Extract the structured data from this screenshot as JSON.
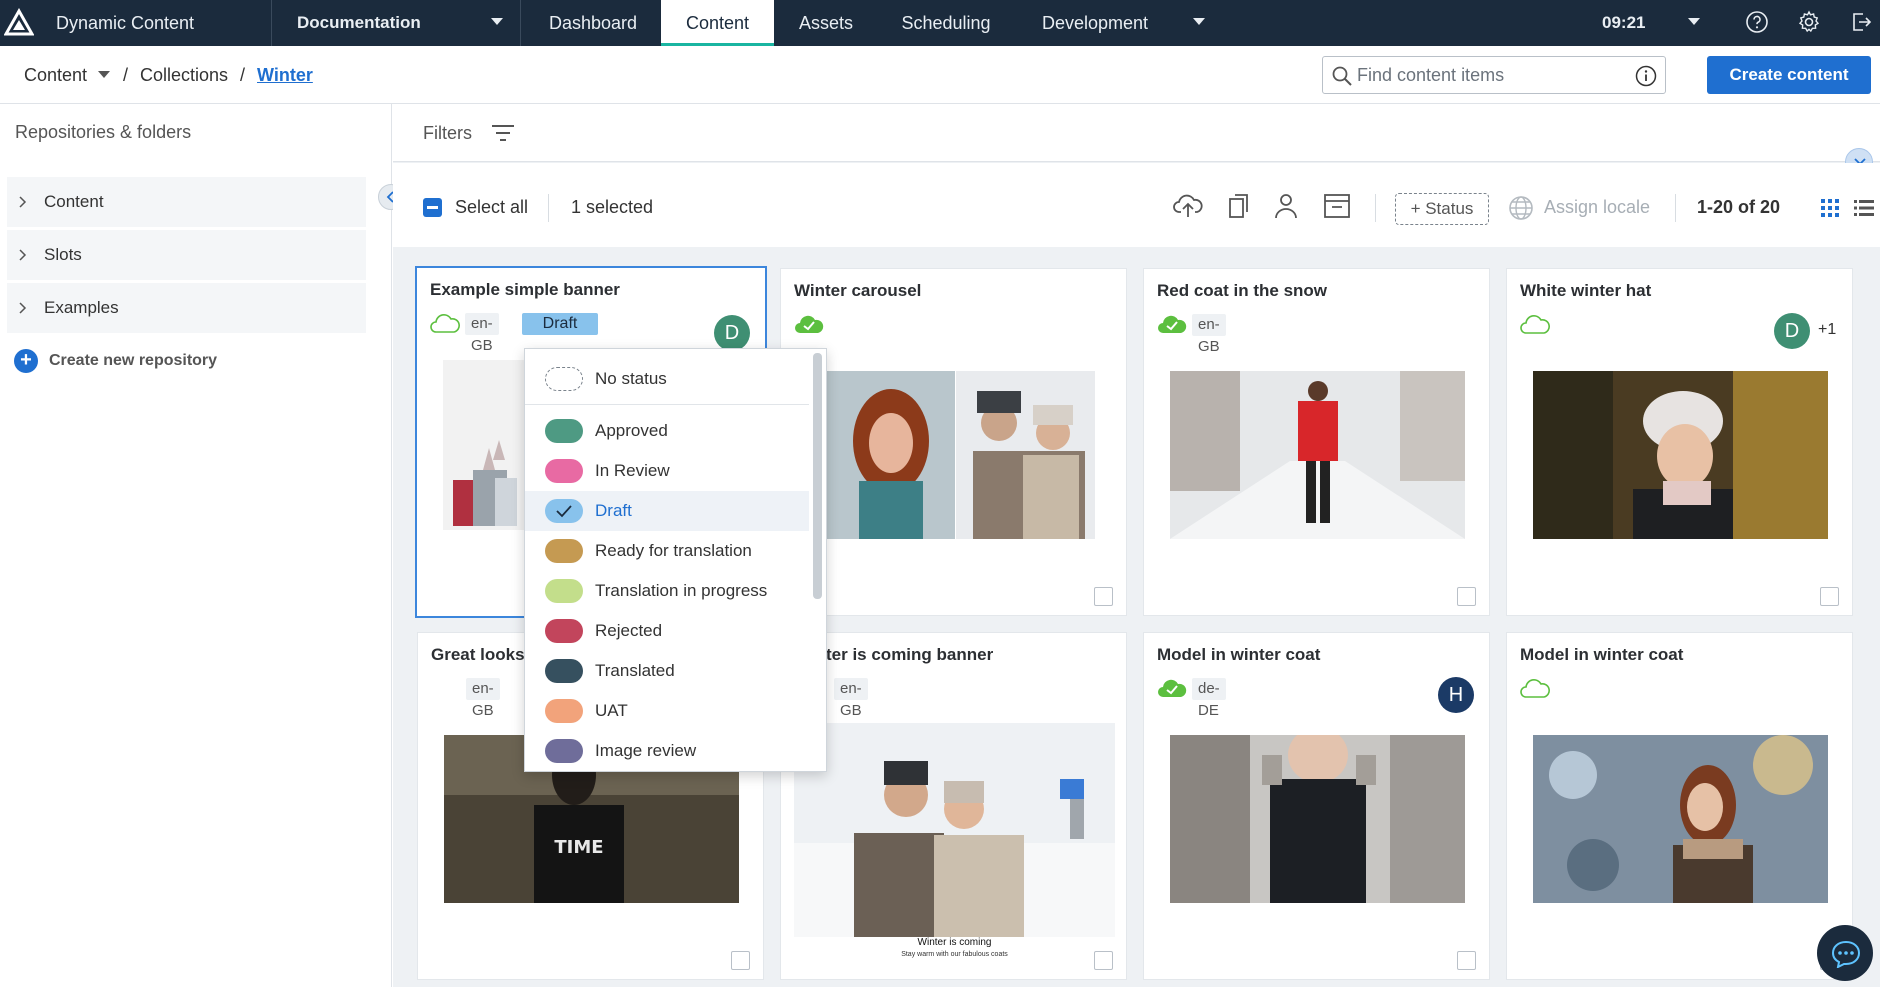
{
  "topbar": {
    "app_name": "Dynamic Content",
    "hub_name": "Documentation",
    "tabs": [
      {
        "label": "Dashboard"
      },
      {
        "label": "Content"
      },
      {
        "label": "Assets"
      },
      {
        "label": "Scheduling"
      },
      {
        "label": "Development"
      }
    ],
    "active_tab": "Content",
    "time": "09:21"
  },
  "breadcrumb": {
    "root": "Content",
    "sep1": "/",
    "collections": "Collections",
    "sep2": "/",
    "current": "Winter"
  },
  "search": {
    "placeholder": "Find content items"
  },
  "create_button": "Create content",
  "sidebar": {
    "title": "Repositories & folders",
    "items": [
      {
        "label": "Content"
      },
      {
        "label": "Slots"
      },
      {
        "label": "Examples"
      }
    ],
    "create_repo": "Create new repository"
  },
  "filters": {
    "label": "Filters"
  },
  "toolbar": {
    "select_all": "Select all",
    "selected_count": "1 selected",
    "status_button": "+ Status",
    "assign_locale": "Assign locale",
    "paging": "1-20 of 20"
  },
  "cards": [
    {
      "title": "Example simple banner",
      "locale": "en-GB",
      "status": "Draft",
      "avatar": "D",
      "avatar_color": "#3f8f73",
      "selected": true
    },
    {
      "title": "Winter carousel",
      "synced": true
    },
    {
      "title": "Red coat in the snow",
      "locale": "en-GB",
      "synced": true
    },
    {
      "title": "White winter hat",
      "avatar": "D",
      "avatar_color": "#3f8f73",
      "extra": "+1"
    },
    {
      "title": "Great looks",
      "locale": "en-GB"
    },
    {
      "title": "ter is coming banner",
      "locale": "en-GB",
      "banner_heading": "Winter is coming",
      "banner_sub": "Stay warm with our fabulous coats"
    },
    {
      "title": "Model in winter coat",
      "locale": "de-DE",
      "synced": true,
      "avatar": "H",
      "avatar_color": "#1b3a66"
    },
    {
      "title": "Model in winter coat"
    }
  ],
  "status_menu": {
    "items": [
      {
        "label": "No status",
        "color": ""
      },
      {
        "label": "Approved",
        "color": "#4e9a83"
      },
      {
        "label": "In Review",
        "color": "#e86aa3"
      },
      {
        "label": "Draft",
        "color": "#88c2ec",
        "checked": true
      },
      {
        "label": "Ready for translation",
        "color": "#c59a52"
      },
      {
        "label": "Translation in progress",
        "color": "#c3de8b"
      },
      {
        "label": "Rejected",
        "color": "#c2455c"
      },
      {
        "label": "Translated",
        "color": "#36505f"
      },
      {
        "label": "UAT",
        "color": "#f2a37b"
      },
      {
        "label": "Image review",
        "color": "#6f6d9a"
      }
    ]
  },
  "colors": {
    "accent": "#1f6fd0",
    "topbar_bg": "#1b2b3d",
    "active_tab_underline": "#19b5a1",
    "sync_green": "#5cbf3f"
  }
}
